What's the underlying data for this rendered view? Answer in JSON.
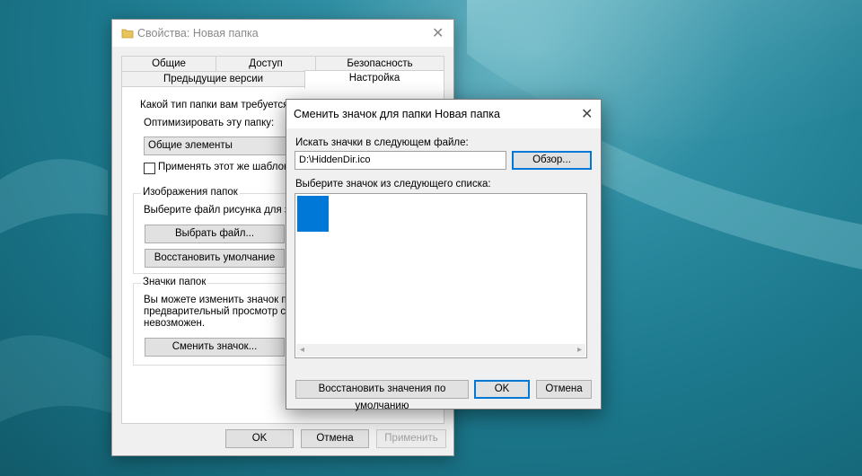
{
  "properties_window": {
    "title": "Свойства: Новая папка",
    "tabs_row1": [
      "Общие",
      "Доступ",
      "Безопасность"
    ],
    "tabs_row2": [
      "Предыдущие версии",
      "Настройка"
    ],
    "active_tab": "Настройка",
    "section_type": {
      "question": "Какой тип папки вам требуется?",
      "optimize_label": "Оптимизировать эту папку:",
      "optimize_value": "Общие элементы",
      "apply_template_label": "Применять этот же шаблон к"
    },
    "section_images": {
      "title": "Изображения папок",
      "description": "Выберите файл рисунка для зн",
      "choose_file_button": "Выбрать файл...",
      "restore_default_button": "Восстановить умолчание"
    },
    "section_icons": {
      "title": "Значки папок",
      "description_lines": [
        "Вы можете изменить значок па",
        "предварительный просмотр сод",
        "невозможен."
      ],
      "change_icon_button": "Сменить значок..."
    },
    "buttons": {
      "ok": "OK",
      "cancel": "Отмена",
      "apply": "Применить"
    }
  },
  "change_icon_dialog": {
    "title": "Сменить значок для папки Новая папка",
    "search_label": "Искать значки в следующем файле:",
    "file_path": "D:\\HiddenDir.ico",
    "browse_button": "Обзор...",
    "list_label": "Выберите значок из следующего списка:",
    "restore_button": "Восстановить значения по умолчанию",
    "ok_button": "OK",
    "cancel_button": "Отмена",
    "selected_icon_color": "#0078d7"
  },
  "icons": {
    "folder_icon": "folder-icon",
    "close_icon": "close-icon",
    "scroll_left_icon": "chevron-left-icon",
    "scroll_right_icon": "chevron-right-icon"
  }
}
